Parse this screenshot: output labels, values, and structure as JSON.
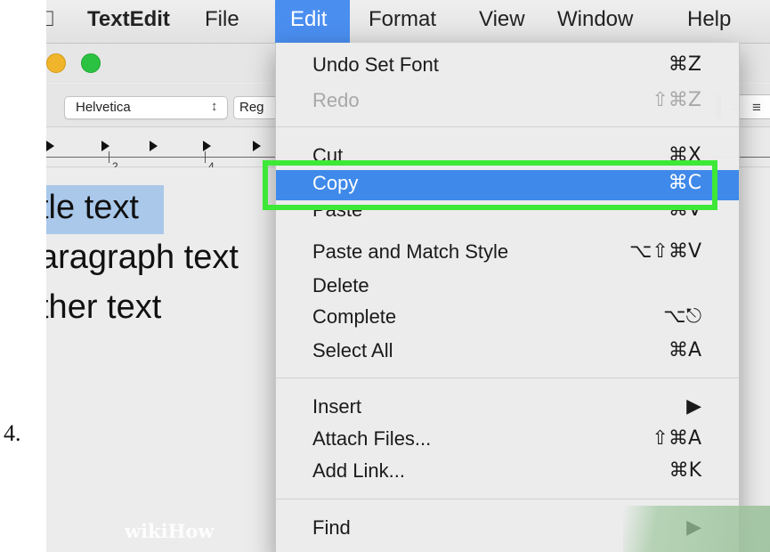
{
  "step_number": "4.",
  "menubar": {
    "apple_glyph": "",
    "app_name": "TextEdit",
    "items": [
      "File",
      "Edit",
      "Format",
      "View",
      "Window",
      "Help"
    ],
    "active_item": "Edit",
    "highlight_color": "#4a8ef0"
  },
  "window": {
    "traffic_lights": [
      "yellow",
      "green"
    ],
    "toolbar": {
      "font_family": "Helvetica",
      "font_family_arrows": "↕",
      "font_style_partial": "Reg",
      "alignment_icons": [
        "align-left-icon",
        "align-center-icon"
      ]
    },
    "ruler": {
      "numbers": [
        "2",
        "4"
      ]
    },
    "document": {
      "lines": [
        "tle text",
        "aragraph text",
        "ther text"
      ],
      "selection_color": "#a9c8ea"
    }
  },
  "edit_menu": {
    "groups": [
      [
        {
          "label": "Undo Set Font",
          "shortcut": "⌘Z",
          "enabled": true
        },
        {
          "label": "Redo",
          "shortcut": "⇧⌘Z",
          "enabled": false
        }
      ],
      [
        {
          "label": "Cut",
          "shortcut": "⌘X",
          "enabled": true
        },
        {
          "label": "Copy",
          "shortcut": "⌘C",
          "enabled": true,
          "highlighted": true
        },
        {
          "label": "Paste",
          "shortcut": "⌘V",
          "enabled": true
        },
        {
          "label": "Paste and Match Style",
          "shortcut": "⌥⇧⌘V",
          "enabled": true
        },
        {
          "label": "Delete",
          "shortcut": "",
          "enabled": true
        },
        {
          "label": "Complete",
          "shortcut": "⌥⎋",
          "enabled": true
        },
        {
          "label": "Select All",
          "shortcut": "⌘A",
          "enabled": true
        }
      ],
      [
        {
          "label": "Insert",
          "shortcut": "▶",
          "enabled": true
        },
        {
          "label": "Attach Files...",
          "shortcut": "⇧⌘A",
          "enabled": true
        },
        {
          "label": "Add Link...",
          "shortcut": "⌘K",
          "enabled": true
        }
      ],
      [
        {
          "label": "Find",
          "shortcut": "▶",
          "enabled": true
        }
      ]
    ],
    "highlight_color": "#3f89ea",
    "callout_color": "#3ee838"
  },
  "watermark": {
    "text": "wikiHow"
  }
}
